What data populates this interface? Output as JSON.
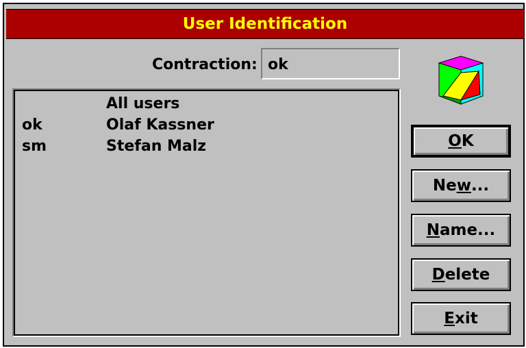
{
  "window": {
    "title": "User Identification"
  },
  "contraction": {
    "label": "Contraction:",
    "value": "ok"
  },
  "users": [
    {
      "code": "",
      "name": "All users"
    },
    {
      "code": "ok",
      "name": "Olaf Kassner"
    },
    {
      "code": "sm",
      "name": "Stefan Malz"
    }
  ],
  "buttons": {
    "ok": {
      "label": "OK",
      "mnemonic": "O"
    },
    "new": {
      "label": "New...",
      "mnemonic": "w"
    },
    "name": {
      "label": "Name...",
      "mnemonic": "N"
    },
    "delete": {
      "label": "Delete",
      "mnemonic": "D"
    },
    "exit": {
      "label": "Exit",
      "mnemonic": "E"
    }
  },
  "icon": "colored-cube-icon",
  "colors": {
    "titlebar": "#aa0000",
    "title_text": "#ffff00",
    "face": "#c0c0c0"
  }
}
